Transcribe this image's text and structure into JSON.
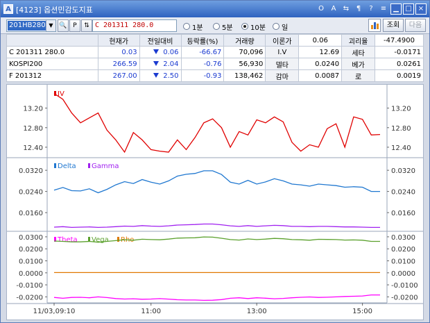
{
  "window": {
    "screen_no": "[4123]",
    "title": "옵션민감도지표",
    "title_buttons": [
      "help-o-icon",
      "font-a-icon",
      "link-icon",
      "settings-icon",
      "question-icon",
      "list-icon",
      "minimize-icon",
      "maximize-icon",
      "close-icon"
    ],
    "title_button_glyphs": [
      "O",
      "A",
      "⇆",
      "¶",
      "?",
      "≡",
      "▁",
      "□",
      "×"
    ]
  },
  "toolbar": {
    "code_value": "201HB280",
    "search_glyph": "🔍",
    "p_glyph": "P",
    "stepper_glyph": "⇅",
    "option_name": "C 201311 280.0",
    "intervals": [
      {
        "label": "1분",
        "selected": false
      },
      {
        "label": "5분",
        "selected": false
      },
      {
        "label": "10분",
        "selected": true
      },
      {
        "label": "일",
        "selected": false
      }
    ],
    "query_label": "조회",
    "next_label": "다음"
  },
  "quote_table": {
    "headers": [
      "",
      "현재가",
      "전일대비",
      "등락률(%)",
      "거래량",
      "이론가",
      "0.06",
      "괴리율",
      "-47.4900"
    ],
    "rows": [
      {
        "name": "C 201311 280.0",
        "price": "0.03",
        "change": "0.06",
        "rate": "-66.67",
        "volume": "70,096",
        "greek_label": "I.V",
        "greek_value": "12.69",
        "greek2_label": "세타",
        "greek2_value": "-0.0171"
      },
      {
        "name": "KOSPI200",
        "price": "266.59",
        "change": "2.04",
        "rate": "-0.76",
        "volume": "56,930",
        "greek_label": "델타",
        "greek_value": "0.0240",
        "greek2_label": "베가",
        "greek2_value": "0.0261"
      },
      {
        "name": "F 201312",
        "price": "267.00",
        "change": "2.50",
        "rate": "-0.93",
        "volume": "138,462",
        "greek_label": "감마",
        "greek_value": "0.0087",
        "greek2_label": "로",
        "greek2_value": "0.0019"
      }
    ]
  },
  "chart_data": [
    {
      "type": "line",
      "panel": "iv",
      "legend": [
        "IV"
      ],
      "ylim": [
        12.2,
        13.65
      ],
      "yticks": [
        "13.20",
        "12.80",
        "12.40"
      ],
      "ytick_values": [
        13.2,
        12.8,
        12.4
      ],
      "series": [
        {
          "name": "IV",
          "color": "#e00000",
          "values": [
            13.5,
            13.38,
            13.1,
            12.9,
            13.0,
            13.1,
            12.75,
            12.55,
            12.3,
            12.7,
            12.55,
            12.35,
            12.32,
            12.3,
            12.55,
            12.35,
            12.6,
            12.9,
            12.98,
            12.8,
            12.4,
            12.72,
            12.65,
            12.96,
            12.9,
            13.02,
            12.92,
            12.5,
            12.32,
            12.45,
            12.4,
            12.78,
            12.88,
            12.4,
            13.02,
            12.97,
            12.65,
            12.66
          ]
        }
      ]
    },
    {
      "type": "line",
      "panel": "delta-gamma",
      "legend": [
        "Delta",
        "Gamma"
      ],
      "ylim": [
        0.0092,
        0.0365
      ],
      "yticks": [
        "0.0320",
        "0.0240",
        "0.0160"
      ],
      "ytick_values": [
        0.032,
        0.024,
        0.016
      ],
      "series": [
        {
          "name": "Delta",
          "color": "#1f77d0",
          "values": [
            0.0245,
            0.0255,
            0.0243,
            0.0242,
            0.025,
            0.0235,
            0.0248,
            0.0265,
            0.0277,
            0.027,
            0.0285,
            0.0275,
            0.0268,
            0.028,
            0.0298,
            0.0305,
            0.0308,
            0.0318,
            0.0318,
            0.0304,
            0.0275,
            0.0268,
            0.0282,
            0.0268,
            0.0276,
            0.0288,
            0.028,
            0.0268,
            0.0265,
            0.026,
            0.0268,
            0.0265,
            0.0262,
            0.0256,
            0.0258,
            0.0256,
            0.024,
            0.024
          ]
        },
        {
          "name": "Gamma",
          "color": "#a020f0",
          "values": [
            0.0105,
            0.0107,
            0.0104,
            0.0105,
            0.0106,
            0.0104,
            0.0105,
            0.0107,
            0.0109,
            0.0108,
            0.0111,
            0.0109,
            0.0108,
            0.011,
            0.0113,
            0.0114,
            0.0115,
            0.0117,
            0.0117,
            0.0114,
            0.011,
            0.0108,
            0.0111,
            0.0108,
            0.011,
            0.0112,
            0.0111,
            0.0108,
            0.0108,
            0.0107,
            0.0108,
            0.0108,
            0.0107,
            0.0106,
            0.0106,
            0.0105,
            0.0104,
            0.0104
          ]
        }
      ]
    },
    {
      "type": "line",
      "panel": "theta-vega-rho",
      "legend": [
        "Theta",
        "Vega",
        "Rho"
      ],
      "ylim": [
        -0.025,
        0.034
      ],
      "yticks": [
        "0.0300",
        "0.0200",
        "0.0100",
        "0.0000",
        "-0.0100",
        "-0.0200"
      ],
      "ytick_values": [
        0.03,
        0.02,
        0.01,
        0.0,
        -0.01,
        -0.02
      ],
      "xticks": [
        "11/03,09:10",
        "11:00",
        "13:00",
        "15:00"
      ],
      "xtick_index": [
        0,
        11,
        23,
        35
      ],
      "series": [
        {
          "name": "Theta",
          "color": "#ff00ff",
          "values": [
            -0.0205,
            -0.0212,
            -0.0205,
            -0.0204,
            -0.0208,
            -0.02,
            -0.0206,
            -0.0214,
            -0.0218,
            -0.0216,
            -0.022,
            -0.0218,
            -0.0215,
            -0.0219,
            -0.0224,
            -0.0226,
            -0.0226,
            -0.0229,
            -0.0228,
            -0.0223,
            -0.0212,
            -0.0208,
            -0.0214,
            -0.0208,
            -0.0211,
            -0.0216,
            -0.0213,
            -0.0208,
            -0.0204,
            -0.0201,
            -0.0205,
            -0.0203,
            -0.02,
            -0.0197,
            -0.0195,
            -0.0193,
            -0.0184,
            -0.0184
          ]
        },
        {
          "name": "Vega",
          "color": "#5aa02c",
          "values": [
            0.0265,
            0.0262,
            0.0258,
            0.0258,
            0.0262,
            0.0255,
            0.0262,
            0.0268,
            0.0276,
            0.0272,
            0.028,
            0.0277,
            0.0275,
            0.0281,
            0.0289,
            0.0291,
            0.0292,
            0.0299,
            0.0297,
            0.0288,
            0.0277,
            0.0273,
            0.0282,
            0.0277,
            0.0281,
            0.0287,
            0.0284,
            0.0277,
            0.0275,
            0.0272,
            0.0279,
            0.0278,
            0.0277,
            0.0273,
            0.0274,
            0.0272,
            0.0262,
            0.0262
          ]
        },
        {
          "name": "Rho",
          "color": "#e07800",
          "values": [
            0.0002,
            0.0002,
            0.0002,
            0.0002,
            0.0002,
            0.0002,
            0.0002,
            0.0002,
            0.0002,
            0.0002,
            0.0002,
            0.0002,
            0.0002,
            0.0002,
            0.0002,
            0.0002,
            0.0002,
            0.0002,
            0.0002,
            0.0002,
            0.0002,
            0.0002,
            0.0002,
            0.0002,
            0.0002,
            0.0002,
            0.0002,
            0.0002,
            0.0002,
            0.0002,
            0.0002,
            0.0002,
            0.0002,
            0.0002,
            0.0002,
            0.0002,
            0.0002,
            0.0002
          ]
        }
      ]
    }
  ]
}
